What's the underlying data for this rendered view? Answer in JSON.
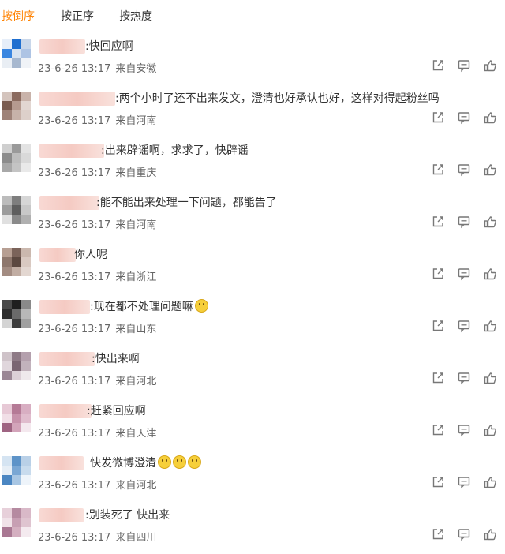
{
  "tabs": [
    "按倒序",
    "按正序",
    "按热度"
  ],
  "comments": [
    {
      "text": ":快回应啊",
      "time": "23-6-26 13:17",
      "location": "来自安徽"
    },
    {
      "text": ":两个小时了还不出来发文，澄清也好承认也好，这样对得起粉丝吗",
      "time": "23-6-26 13:17",
      "location": "来自河南"
    },
    {
      "text": ":出来辟谣啊，求求了，快辟谣",
      "time": "23-6-26 13:17",
      "location": "来自重庆"
    },
    {
      "text": ":能不能出来处理一下问题，都能告了",
      "time": "23-6-26 13:17",
      "location": "来自河南"
    },
    {
      "text": "你人呢",
      "time": "23-6-26 13:17",
      "location": "来自浙江"
    },
    {
      "text": ":现在都不处理问题嘛",
      "time": "23-6-26 13:17",
      "location": "来自山东"
    },
    {
      "text": ":快出来啊",
      "time": "23-6-26 13:17",
      "location": "来自河北"
    },
    {
      "text": ":赶紧回应啊",
      "time": "23-6-26 13:17",
      "location": "来自天津"
    },
    {
      "text": "快发微博澄清",
      "time": "23-6-26 13:17",
      "location": "来自河北"
    },
    {
      "text": ":别装死了 快出来",
      "time": "23-6-26 13:17",
      "location": "来自四川"
    }
  ],
  "icons": {
    "share": "share-icon",
    "comment": "comment-icon",
    "like": "like-icon"
  },
  "colors": {
    "active_tab": "#ff8200",
    "text": "#333333",
    "meta": "#666666"
  }
}
